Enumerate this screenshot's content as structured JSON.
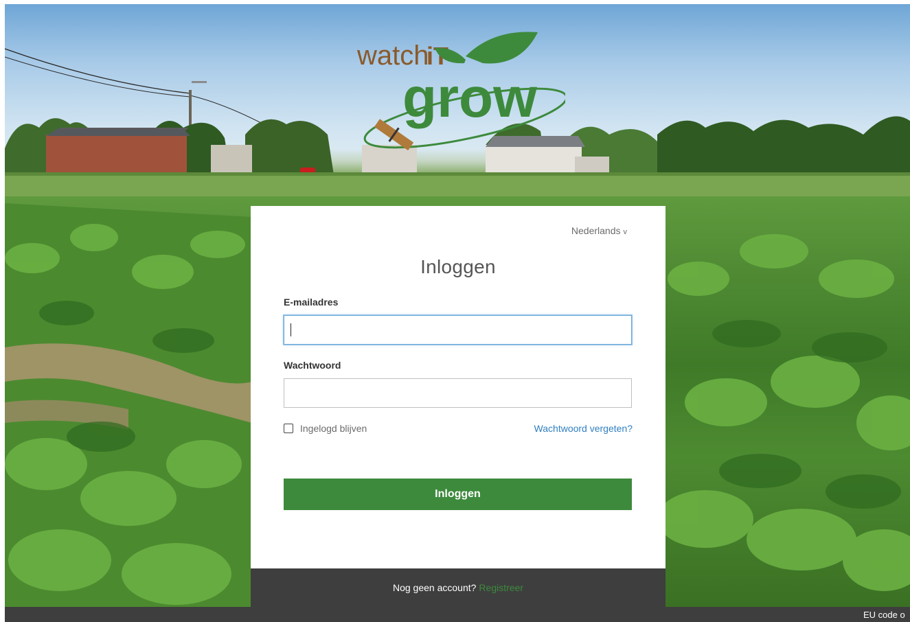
{
  "logo": {
    "text_watch": "watch",
    "text_it": "iT",
    "text_grow": "grow"
  },
  "login": {
    "language": "Nederlands",
    "title": "Inloggen",
    "email_label": "E-mailadres",
    "email_value": "",
    "password_label": "Wachtwoord",
    "password_value": "",
    "remember_label": "Ingelogd blijven",
    "remember_checked": false,
    "forgot_link": "Wachtwoord vergeten?",
    "submit_label": "Inloggen"
  },
  "footer": {
    "prompt": "Nog geen account?",
    "register_link": "Registreer"
  },
  "bottom_bar": {
    "text": "EU code o"
  },
  "colors": {
    "brand_green": "#3d8a3c",
    "link_blue": "#2f7fc1",
    "footer_dark": "#3e3e3e",
    "logo_brown": "#8a5a2b"
  }
}
